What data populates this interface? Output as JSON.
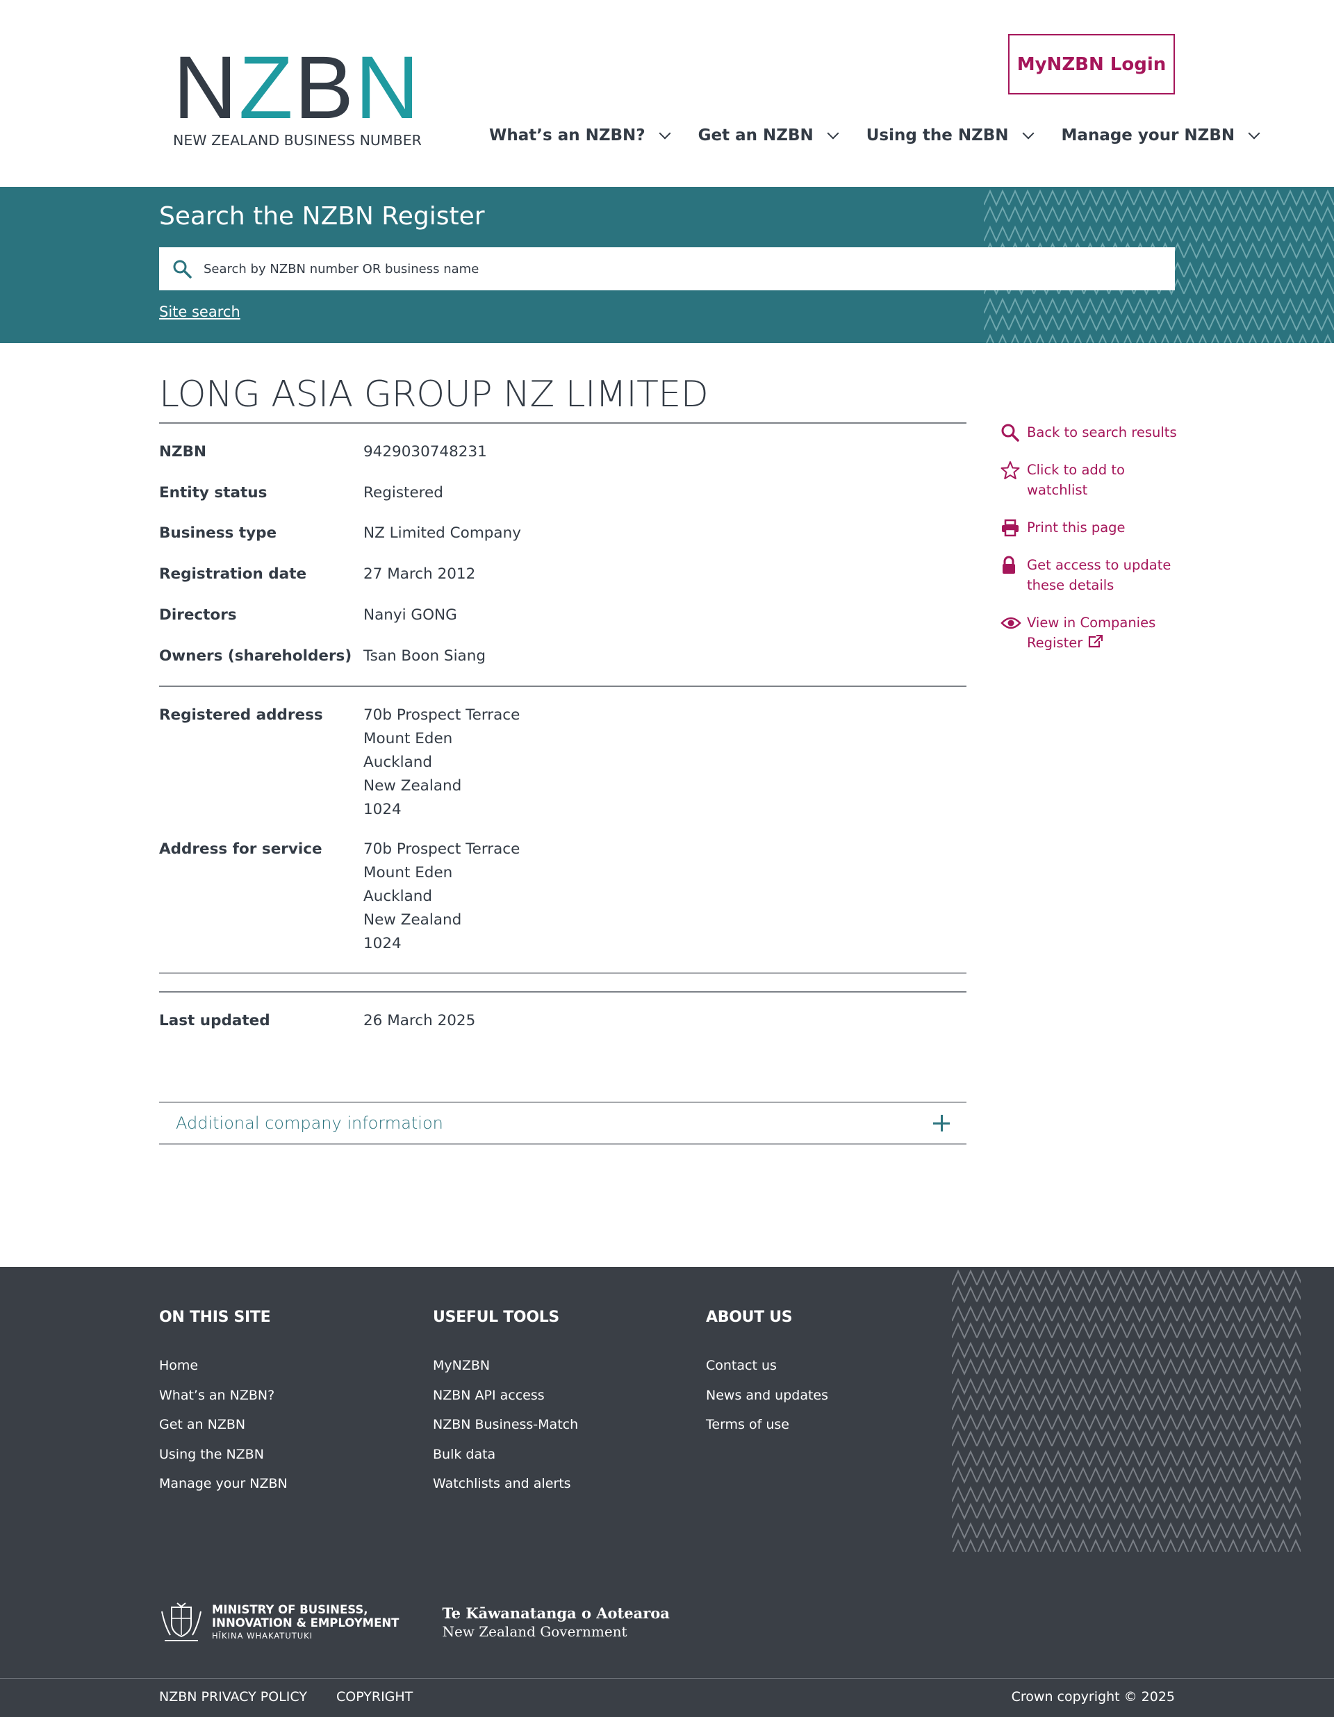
{
  "header": {
    "logo_letters": [
      "N",
      "Z",
      "B",
      "N"
    ],
    "logo_subtitle": "NEW ZEALAND BUSINESS NUMBER",
    "login_label": "MyNZBN Login",
    "nav": [
      {
        "label": "What’s an NZBN?"
      },
      {
        "label": "Get an NZBN"
      },
      {
        "label": "Using the NZBN"
      },
      {
        "label": "Manage your NZBN"
      }
    ]
  },
  "search": {
    "title": "Search the NZBN Register",
    "placeholder": "Search by NZBN number OR business name",
    "site_search_label": "Site search"
  },
  "company": {
    "name": "LONG ASIA GROUP NZ LIMITED",
    "details": [
      {
        "label": "NZBN",
        "value": "9429030748231"
      },
      {
        "label": "Entity status",
        "value": "Registered"
      },
      {
        "label": "Business type",
        "value": "NZ Limited Company"
      },
      {
        "label": "Registration date",
        "value": "27 March 2012"
      },
      {
        "label": "Directors",
        "value": "Nanyi GONG"
      },
      {
        "label": "Owners (shareholders)",
        "value": "Tsan Boon Siang"
      }
    ],
    "registered_address": {
      "label": "Registered address",
      "lines": [
        "70b Prospect Terrace",
        "Mount Eden",
        "Auckland",
        "New Zealand",
        "1024"
      ]
    },
    "service_address": {
      "label": "Address for service",
      "lines": [
        "70b Prospect Terrace",
        "Mount Eden",
        "Auckland",
        "New Zealand",
        "1024"
      ]
    },
    "last_updated": {
      "label": "Last updated",
      "value": "26 March 2025"
    },
    "accordion_label": "Additional company information"
  },
  "sidebar": [
    {
      "icon": "search-icon",
      "lines": [
        "Back to search results"
      ]
    },
    {
      "icon": "star-icon",
      "lines": [
        "Click to add to watchlist"
      ]
    },
    {
      "icon": "printer-icon",
      "lines": [
        "Print this page"
      ]
    },
    {
      "icon": "lock-icon",
      "lines": [
        "Get access to update",
        "these details"
      ]
    },
    {
      "icon": "eye-icon",
      "lines": [
        "View in Companies",
        "Register"
      ]
    }
  ],
  "footer": {
    "columns": [
      {
        "title": "ON THIS SITE",
        "links": [
          "Home",
          "What’s an NZBN?",
          "Get an NZBN",
          "Using the NZBN",
          "Manage your NZBN"
        ]
      },
      {
        "title": "USEFUL TOOLS",
        "links": [
          "MyNZBN",
          "NZBN API access",
          "NZBN Business-Match",
          "Bulk data",
          "Watchlists and alerts"
        ]
      },
      {
        "title": "ABOUT US",
        "links": [
          "Contact us",
          "News and updates",
          "Terms of use"
        ]
      }
    ],
    "mbie": {
      "line1": "MINISTRY OF BUSINESS,",
      "line2": "INNOVATION & EMPLOYMENT",
      "line3": "HĪKINA WHAKATUTUKI"
    },
    "nzgov": {
      "line1": "Te Kāwanatanga o Aotearoa",
      "line2": "New Zealand Government"
    },
    "bottom_links": [
      "NZBN PRIVACY POLICY",
      "COPYRIGHT"
    ],
    "copyright": "Crown copyright © 2025"
  },
  "colors": {
    "teal": "#2b737e",
    "brand_magenta": "#a5165a",
    "logo_teal": "#1f9aa0",
    "text_dark": "#333b45",
    "footer_bg": "#3a3f46"
  }
}
